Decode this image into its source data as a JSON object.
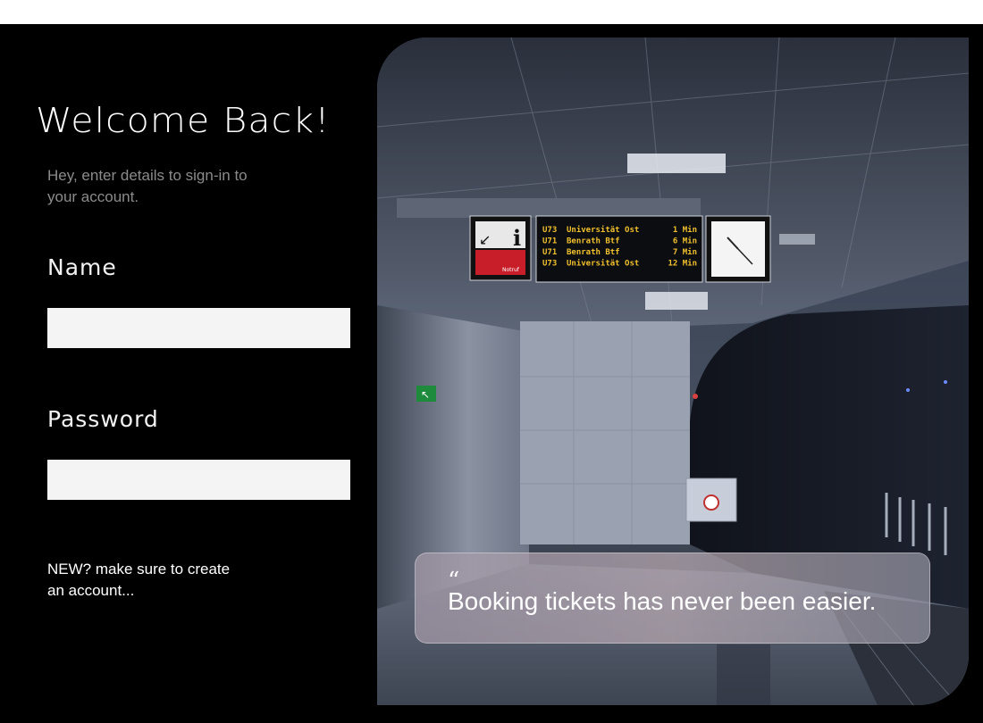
{
  "login": {
    "title": "Welcome Back!",
    "subtitle": "Hey, enter details to sign-in to your account.",
    "name_label": "Name",
    "name_value": "",
    "password_label": "Password",
    "password_value": "",
    "new_account_text": "NEW? make sure to create an account..."
  },
  "hero": {
    "quote_mark": "“",
    "quote_text": "Booking tickets has never been easier.",
    "departure_board": [
      {
        "line": "U73",
        "destination": "Universität Ost",
        "time": "1 Min"
      },
      {
        "line": "U71",
        "destination": "Benrath Btf",
        "time": "6 Min"
      },
      {
        "line": "U71",
        "destination": "Benrath Btf",
        "time": "7 Min"
      },
      {
        "line": "U73",
        "destination": "Universität Ost",
        "time": "12 Min"
      }
    ],
    "info_sign": "i",
    "emergency_sign": "Notruf"
  },
  "colors": {
    "background": "#000000",
    "title": "#ffffff",
    "subtitle": "#8b8b8b",
    "input_bg": "#f4f4f4",
    "board_text": "#f2c12e"
  }
}
